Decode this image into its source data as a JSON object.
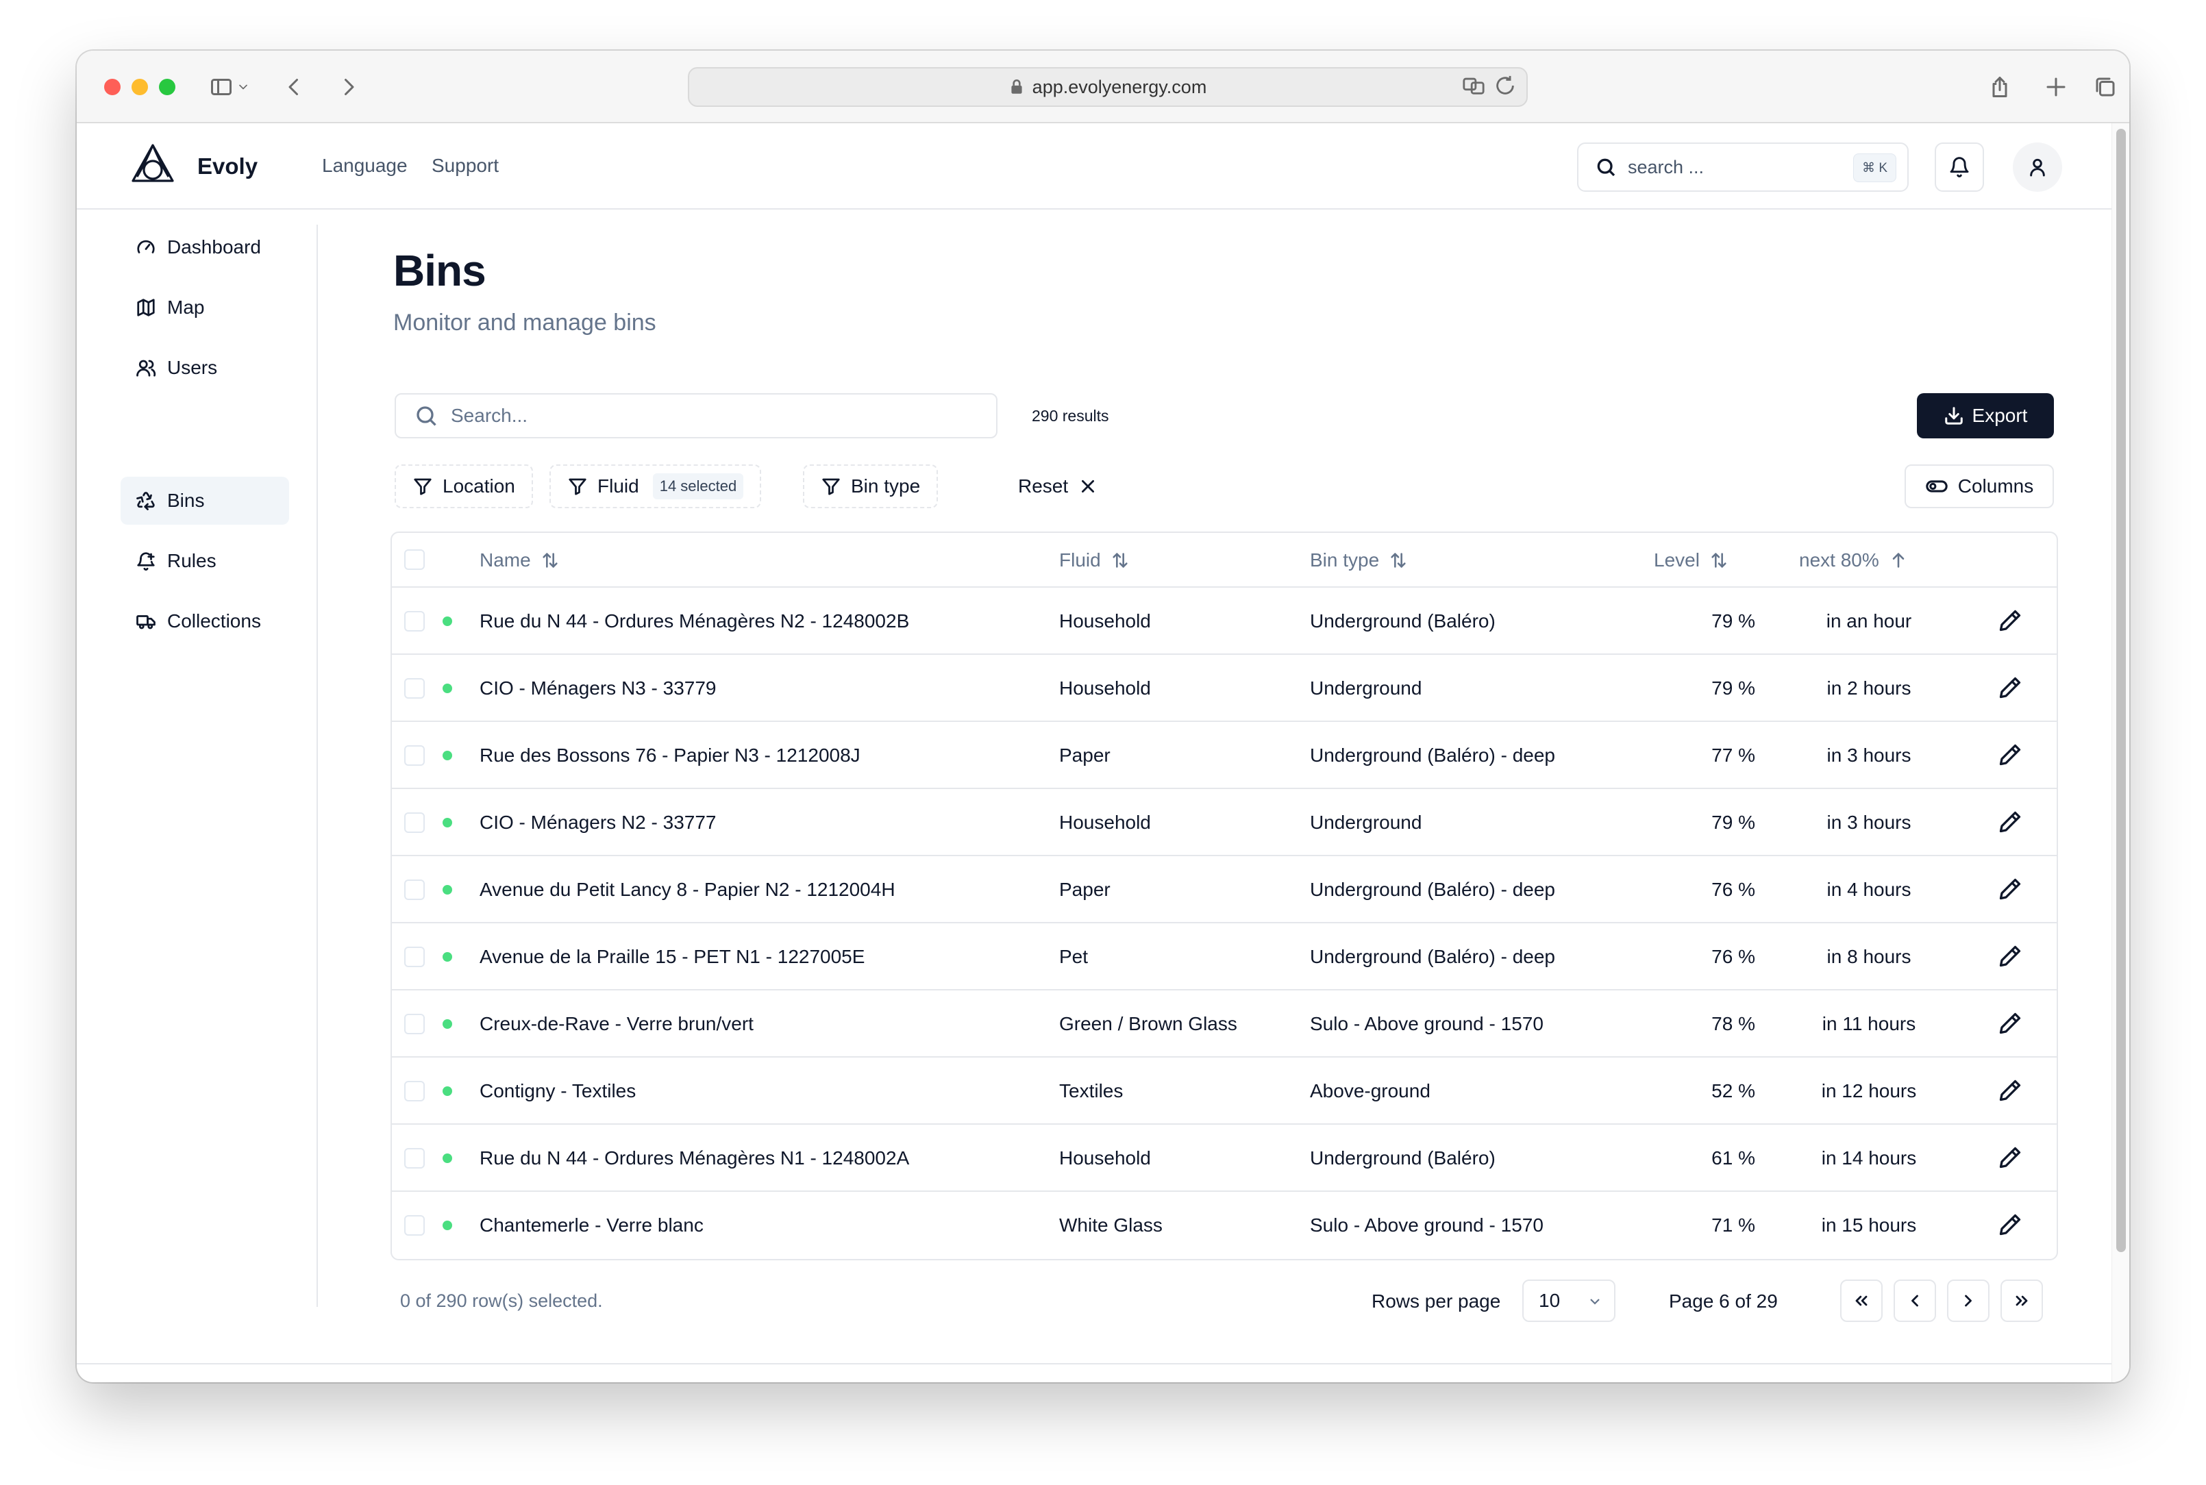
{
  "browser": {
    "url": "app.evolyenergy.com"
  },
  "header": {
    "brand": "Evoly",
    "nav": [
      "Language",
      "Support"
    ],
    "search_placeholder": "search ...",
    "search_shortcut": "⌘ K"
  },
  "sidebar": {
    "items": [
      {
        "label": "Dashboard",
        "icon": "gauge-icon"
      },
      {
        "label": "Map",
        "icon": "map-icon"
      },
      {
        "label": "Users",
        "icon": "users-icon"
      },
      {
        "label": "Bins",
        "icon": "recycle-icon",
        "active": true
      },
      {
        "label": "Rules",
        "icon": "bell-plus-icon"
      },
      {
        "label": "Collections",
        "icon": "truck-icon"
      }
    ]
  },
  "page": {
    "title": "Bins",
    "subtitle": "Monitor and manage bins",
    "search_placeholder": "Search...",
    "results": "290 results",
    "export_label": "Export",
    "filters": {
      "location": "Location",
      "fluid": "Fluid",
      "fluid_badge": "14 selected",
      "bin_type": "Bin type",
      "reset": "Reset"
    },
    "columns_label": "Columns"
  },
  "table": {
    "headers": {
      "name": "Name",
      "fluid": "Fluid",
      "bin_type": "Bin type",
      "level": "Level",
      "next": "next 80%"
    },
    "rows": [
      {
        "name": "Rue du N 44 - Ordures Ménagères N2 - 1248002B",
        "fluid": "Household",
        "bin_type": "Underground (Baléro)",
        "level": "79 %",
        "next": "in an hour"
      },
      {
        "name": "CIO - Ménagers N3 - 33779",
        "fluid": "Household",
        "bin_type": "Underground",
        "level": "79 %",
        "next": "in 2 hours"
      },
      {
        "name": "Rue des Bossons 76 - Papier N3 - 1212008J",
        "fluid": "Paper",
        "bin_type": "Underground (Baléro) - deep",
        "level": "77 %",
        "next": "in 3 hours"
      },
      {
        "name": "CIO - Ménagers N2 - 33777",
        "fluid": "Household",
        "bin_type": "Underground",
        "level": "79 %",
        "next": "in 3 hours"
      },
      {
        "name": "Avenue du Petit Lancy 8 - Papier N2 - 1212004H",
        "fluid": "Paper",
        "bin_type": "Underground (Baléro) - deep",
        "level": "76 %",
        "next": "in 4 hours"
      },
      {
        "name": "Avenue de la Praille 15 - PET N1 - 1227005E",
        "fluid": "Pet",
        "bin_type": "Underground (Baléro) - deep",
        "level": "76 %",
        "next": "in 8 hours"
      },
      {
        "name": "Creux-de-Rave - Verre brun/vert",
        "fluid": "Green / Brown Glass",
        "bin_type": "Sulo - Above ground - 1570",
        "level": "78 %",
        "next": "in 11 hours"
      },
      {
        "name": "Contigny - Textiles",
        "fluid": "Textiles",
        "bin_type": "Above-ground",
        "level": "52 %",
        "next": "in 12 hours"
      },
      {
        "name": "Rue du N 44 - Ordures Ménagères N1 - 1248002A",
        "fluid": "Household",
        "bin_type": "Underground (Baléro)",
        "level": "61 %",
        "next": "in 14 hours"
      },
      {
        "name": "Chantemerle - Verre blanc",
        "fluid": "White Glass",
        "bin_type": "Sulo - Above ground - 1570",
        "level": "71 %",
        "next": "in 15 hours"
      }
    ]
  },
  "footer": {
    "selected": "0 of 290 row(s) selected.",
    "rows_per_page_label": "Rows per page",
    "rows_per_page": "10",
    "page_info": "Page 6 of 29"
  },
  "colors": {
    "status_dot": "#4ade80",
    "primary": "#0f172a"
  }
}
